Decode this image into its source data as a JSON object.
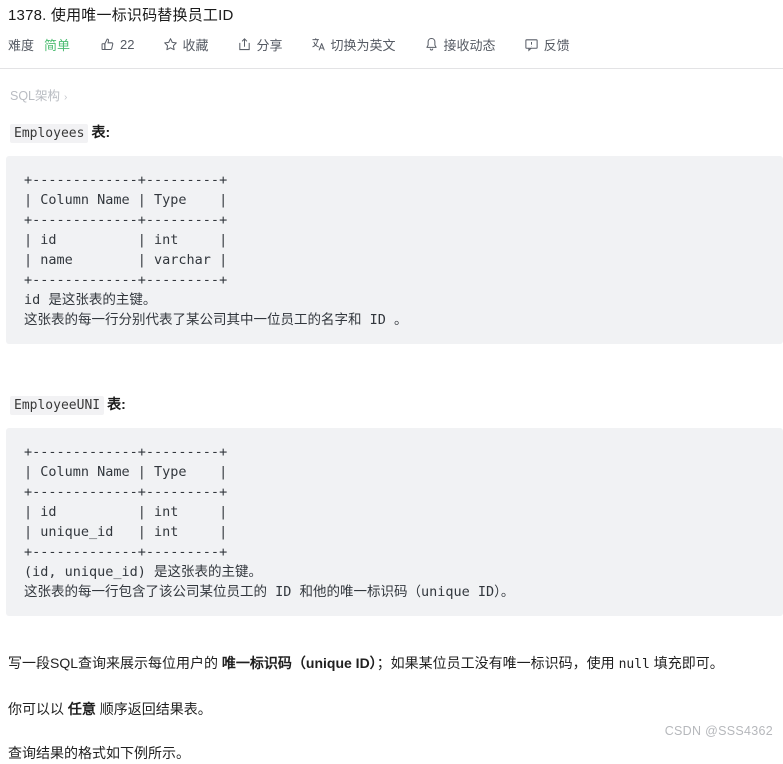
{
  "page": {
    "title": "1378. 使用唯一标识码替换员工ID",
    "breadcrumb": "SQL架构",
    "breadcrumb_chevron": "›",
    "watermark": "CSDN @SSS4362"
  },
  "toolbar": {
    "difficulty_label": "难度",
    "difficulty_value": "简单",
    "difficulty_color": "#4ebd73",
    "items": [
      {
        "icon": "thumbs-up-icon",
        "label": "22"
      },
      {
        "icon": "star-icon",
        "label": "收藏"
      },
      {
        "icon": "share-icon",
        "label": "分享"
      },
      {
        "icon": "translate-icon",
        "label": "切换为英文"
      },
      {
        "icon": "bell-icon",
        "label": "接收动态"
      },
      {
        "icon": "feedback-icon",
        "label": "反馈"
      }
    ]
  },
  "sections": [
    {
      "table_name": "Employees",
      "table_suffix": "表:",
      "code": "+-------------+---------+\n| Column Name | Type    |\n+-------------+---------+\n| id          | int     |\n| name        | varchar |\n+-------------+---------+\nid 是这张表的主键。\n这张表的每一行分别代表了某公司其中一位员工的名字和 ID 。"
    },
    {
      "table_name": "EmployeeUNI",
      "table_suffix": "表:",
      "code": "+-------------+---------+\n| Column Name | Type    |\n+-------------+---------+\n| id          | int     |\n| unique_id   | int     |\n+-------------+---------+\n(id, unique_id) 是这张表的主键。\n这张表的每一行包含了该公司某位员工的 ID 和他的唯一标识码（unique ID）。"
    }
  ],
  "description": {
    "p1_a": "写一段SQL查询来展示每位用户的 ",
    "p1_b": "唯一标识码（unique ID）",
    "p1_c": "；如果某位员工没有唯一标识码，使用 ",
    "p1_d": "null",
    "p1_e": " 填充即可。",
    "p2_a": "你可以以 ",
    "p2_b": "任意",
    "p2_c": " 顺序返回结果表。",
    "p3": "查询结果的格式如下例所示。"
  }
}
